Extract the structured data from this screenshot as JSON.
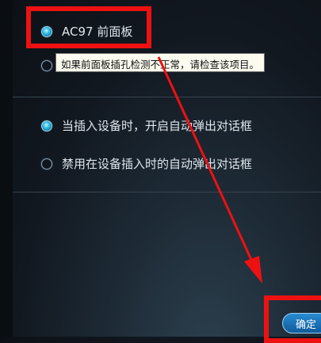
{
  "panel": {
    "ac97_option": {
      "label": "AC97 前面板",
      "selected": true
    },
    "hd_option": {
      "label": "",
      "selected": false
    },
    "tooltip_text": "如果前面板插孔检测不正常，请检查该项目。",
    "auto_popup_option": {
      "label": "当插入设备时，开启自动弹出对话框",
      "selected": true
    },
    "disable_popup_option": {
      "label": "禁用在设备插入时的自动弹出对话框",
      "selected": false
    },
    "ok_label": "确定"
  },
  "annotation": {
    "color": "#ee1111"
  }
}
